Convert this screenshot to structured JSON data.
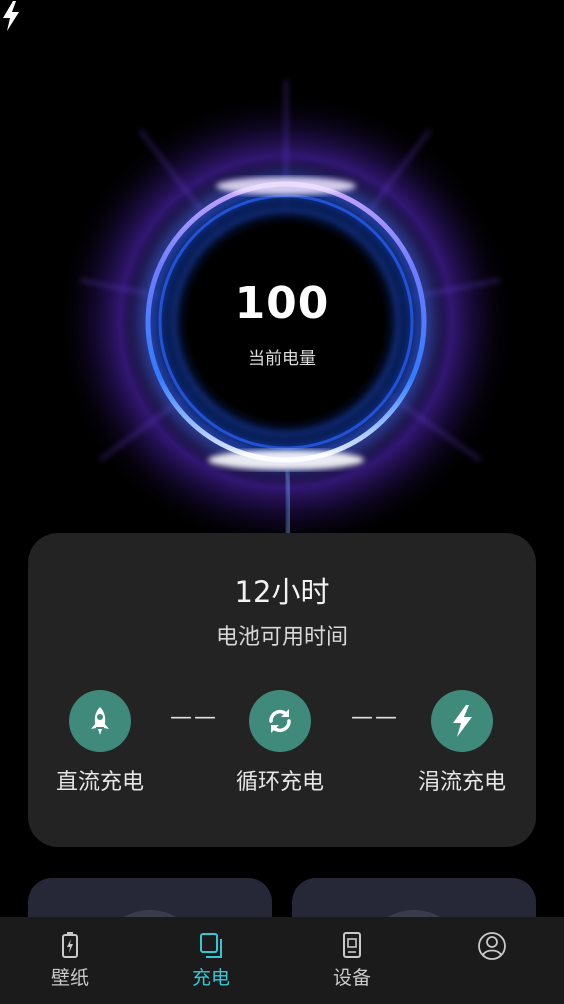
{
  "battery": {
    "level": "100",
    "label": "当前电量"
  },
  "usage": {
    "time_value": "12小时",
    "time_label": "电池可用时间"
  },
  "charge_modes": [
    {
      "label": "直流充电",
      "icon": "rocket-icon"
    },
    {
      "label": "循环充电",
      "icon": "sync-icon"
    },
    {
      "label": "涓流充电",
      "icon": "bolt-icon"
    }
  ],
  "separator": "——",
  "nav": {
    "items": [
      {
        "label": "壁纸",
        "icon": "battery-icon"
      },
      {
        "label": "充电",
        "icon": "layers-icon",
        "active": true
      },
      {
        "label": "设备",
        "icon": "device-icon"
      },
      {
        "label": "",
        "icon": "profile-icon"
      }
    ]
  },
  "colors": {
    "accent": "#36c7d6",
    "mode_circle": "#3f8a7a",
    "card": "#232323",
    "ring_blue": "#3a6bff",
    "ring_purple": "#9a4dff"
  }
}
